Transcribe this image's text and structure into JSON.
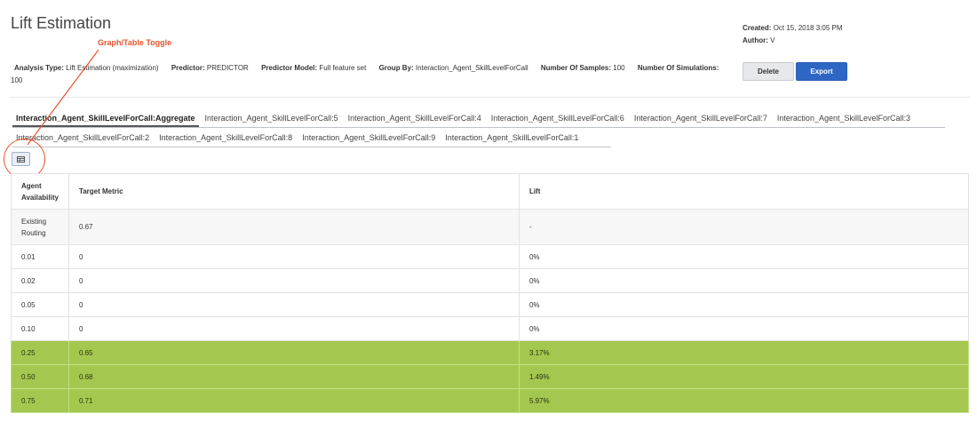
{
  "page": {
    "title": "Lift Estimation"
  },
  "meta": {
    "created_label": "Created:",
    "created_value": "Oct 15, 2018 3:05 PM",
    "author_label": "Author:",
    "author_value": "V"
  },
  "annotation": {
    "callout": "Graph/Table Toggle",
    "color": "#e8542e"
  },
  "info": {
    "analysis_type_label": "Analysis Type:",
    "analysis_type_value": "Lift Estimation (maximization)",
    "predictor_label": "Predictor:",
    "predictor_value": "PREDICTOR",
    "predictor_model_label": "Predictor Model:",
    "predictor_model_value": "Full feature set",
    "group_by_label": "Group By:",
    "group_by_value": "Interaction_Agent_SkillLevelForCall",
    "samples_label": "Number Of Samples:",
    "samples_value": "100",
    "simulations_label": "Number Of Simulations:",
    "simulations_value": "100"
  },
  "actions": {
    "delete_label": "Delete",
    "export_label": "Export",
    "export_color": "#2e66c4"
  },
  "tabs": [
    "Interaction_Agent_SkillLevelForCall:Aggregate",
    "Interaction_Agent_SkillLevelForCall:5",
    "Interaction_Agent_SkillLevelForCall:4",
    "Interaction_Agent_SkillLevelForCall:6",
    "Interaction_Agent_SkillLevelForCall:7",
    "Interaction_Agent_SkillLevelForCall:3",
    "Interaction_Agent_SkillLevelForCall:2",
    "Interaction_Agent_SkillLevelForCall:8",
    "Interaction_Agent_SkillLevelForCall:9",
    "Interaction_Agent_SkillLevelForCall:1"
  ],
  "active_tab": 0,
  "toggle": {
    "icon": "table-icon"
  },
  "table": {
    "columns": [
      "Agent Availability",
      "Target Metric",
      "Lift"
    ],
    "rows": [
      {
        "availability": "Existing Routing",
        "target": "0.67",
        "lift": "-"
      },
      {
        "availability": "0.01",
        "target": "0",
        "lift": "0%"
      },
      {
        "availability": "0.02",
        "target": "0",
        "lift": "0%"
      },
      {
        "availability": "0.05",
        "target": "0",
        "lift": "0%"
      },
      {
        "availability": "0.10",
        "target": "0",
        "lift": "0%"
      },
      {
        "availability": "0.25",
        "target": "0.65",
        "lift": "3.17%"
      },
      {
        "availability": "0.50",
        "target": "0.68",
        "lift": "1.49%"
      },
      {
        "availability": "0.75",
        "target": "0.71",
        "lift": "5.97%"
      }
    ],
    "highlight_color": "#a4c84f"
  }
}
